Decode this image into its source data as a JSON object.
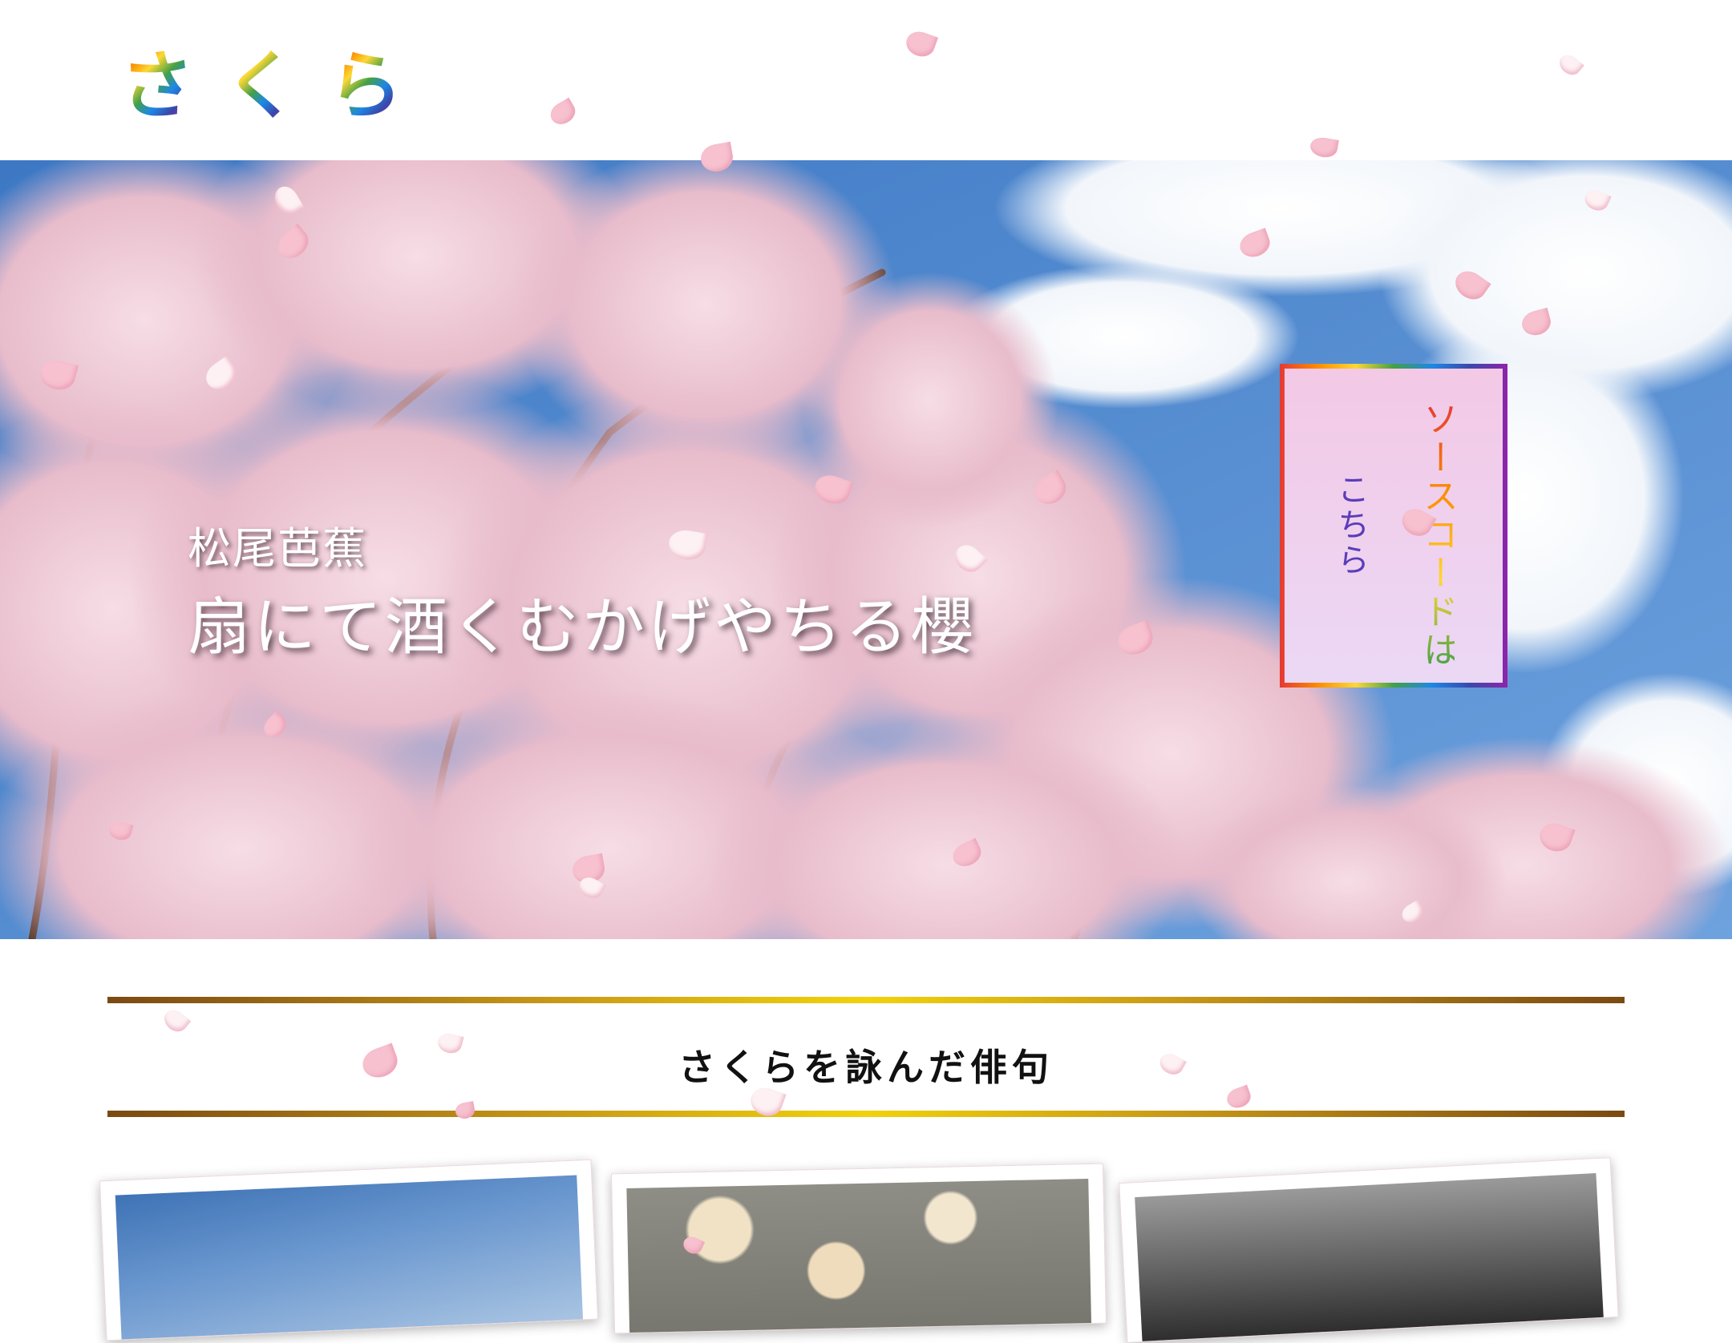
{
  "header": {
    "logo_chars": [
      "さ",
      "く",
      "ら"
    ]
  },
  "hero": {
    "author": "松尾芭蕉",
    "haiku": "扇にて酒くむかげやちる櫻",
    "source_link": {
      "line1": "ソースコードは",
      "line2": "こちら"
    }
  },
  "section": {
    "title": "さくらを詠んだ俳句"
  },
  "colors": {
    "accent_gold": "#f1d20a",
    "rule_brown": "#7a4a12",
    "petal_pink": "#f7c1cf",
    "sky_blue": "#4f86c9"
  },
  "icons": {
    "petal": "sakura-petal-icon"
  }
}
